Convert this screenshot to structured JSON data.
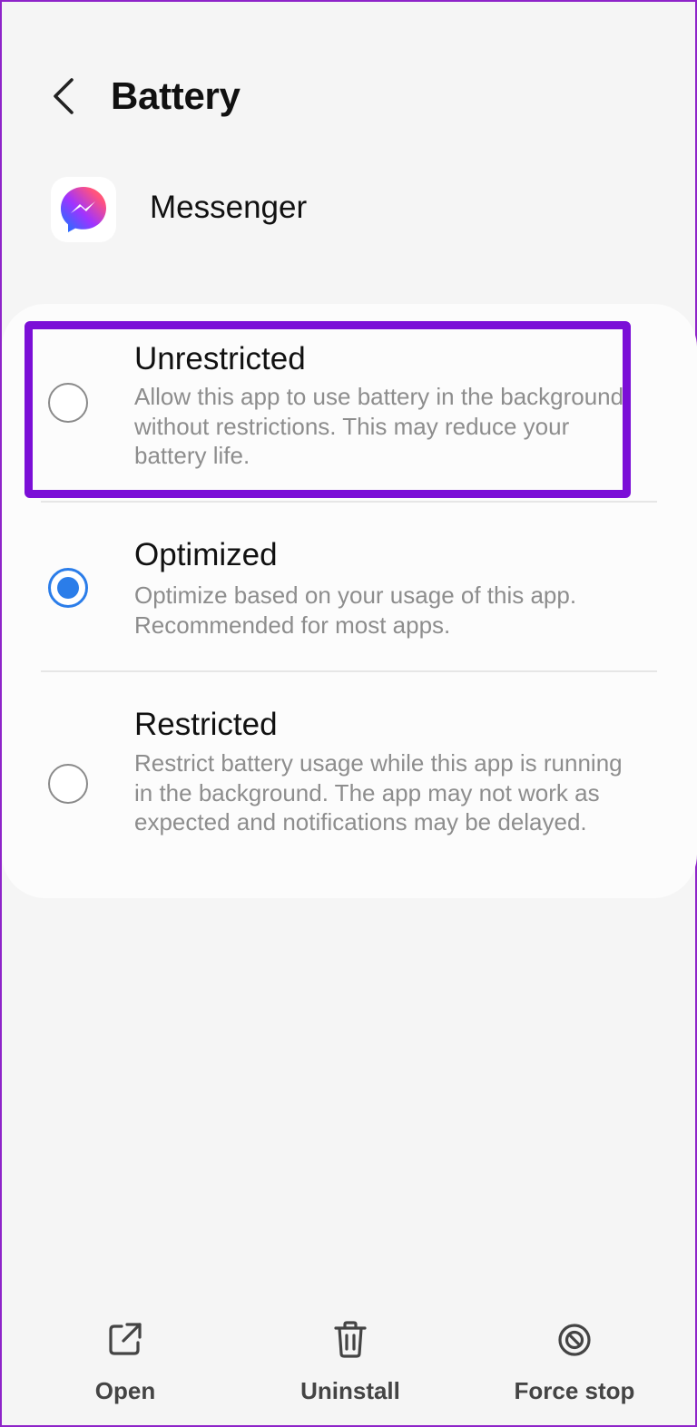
{
  "header": {
    "title": "Battery",
    "back_icon": "chevron-left-icon"
  },
  "app": {
    "name": "Messenger",
    "icon": "messenger-app-icon"
  },
  "options": [
    {
      "title": "Unrestricted",
      "description": "Allow this app to use battery in the background without restrictions. This may reduce your battery life.",
      "selected": false
    },
    {
      "title": "Optimized",
      "description": "Optimize based on your usage of this app. Recommended for most apps.",
      "selected": true
    },
    {
      "title": "Restricted",
      "description": "Restrict battery usage while this app is running in the background. The app may not work as expected and notifications may be delayed.",
      "selected": false
    }
  ],
  "bottom_actions": [
    {
      "label": "Open",
      "icon": "open-external-icon"
    },
    {
      "label": "Uninstall",
      "icon": "trash-icon"
    },
    {
      "label": "Force stop",
      "icon": "block-icon"
    }
  ],
  "colors": {
    "background": "#f5f5f5",
    "card": "#fcfcfc",
    "accent": "#2b7de9",
    "highlight": "#7b0fd7",
    "secondary_text": "#8d8d8d"
  }
}
